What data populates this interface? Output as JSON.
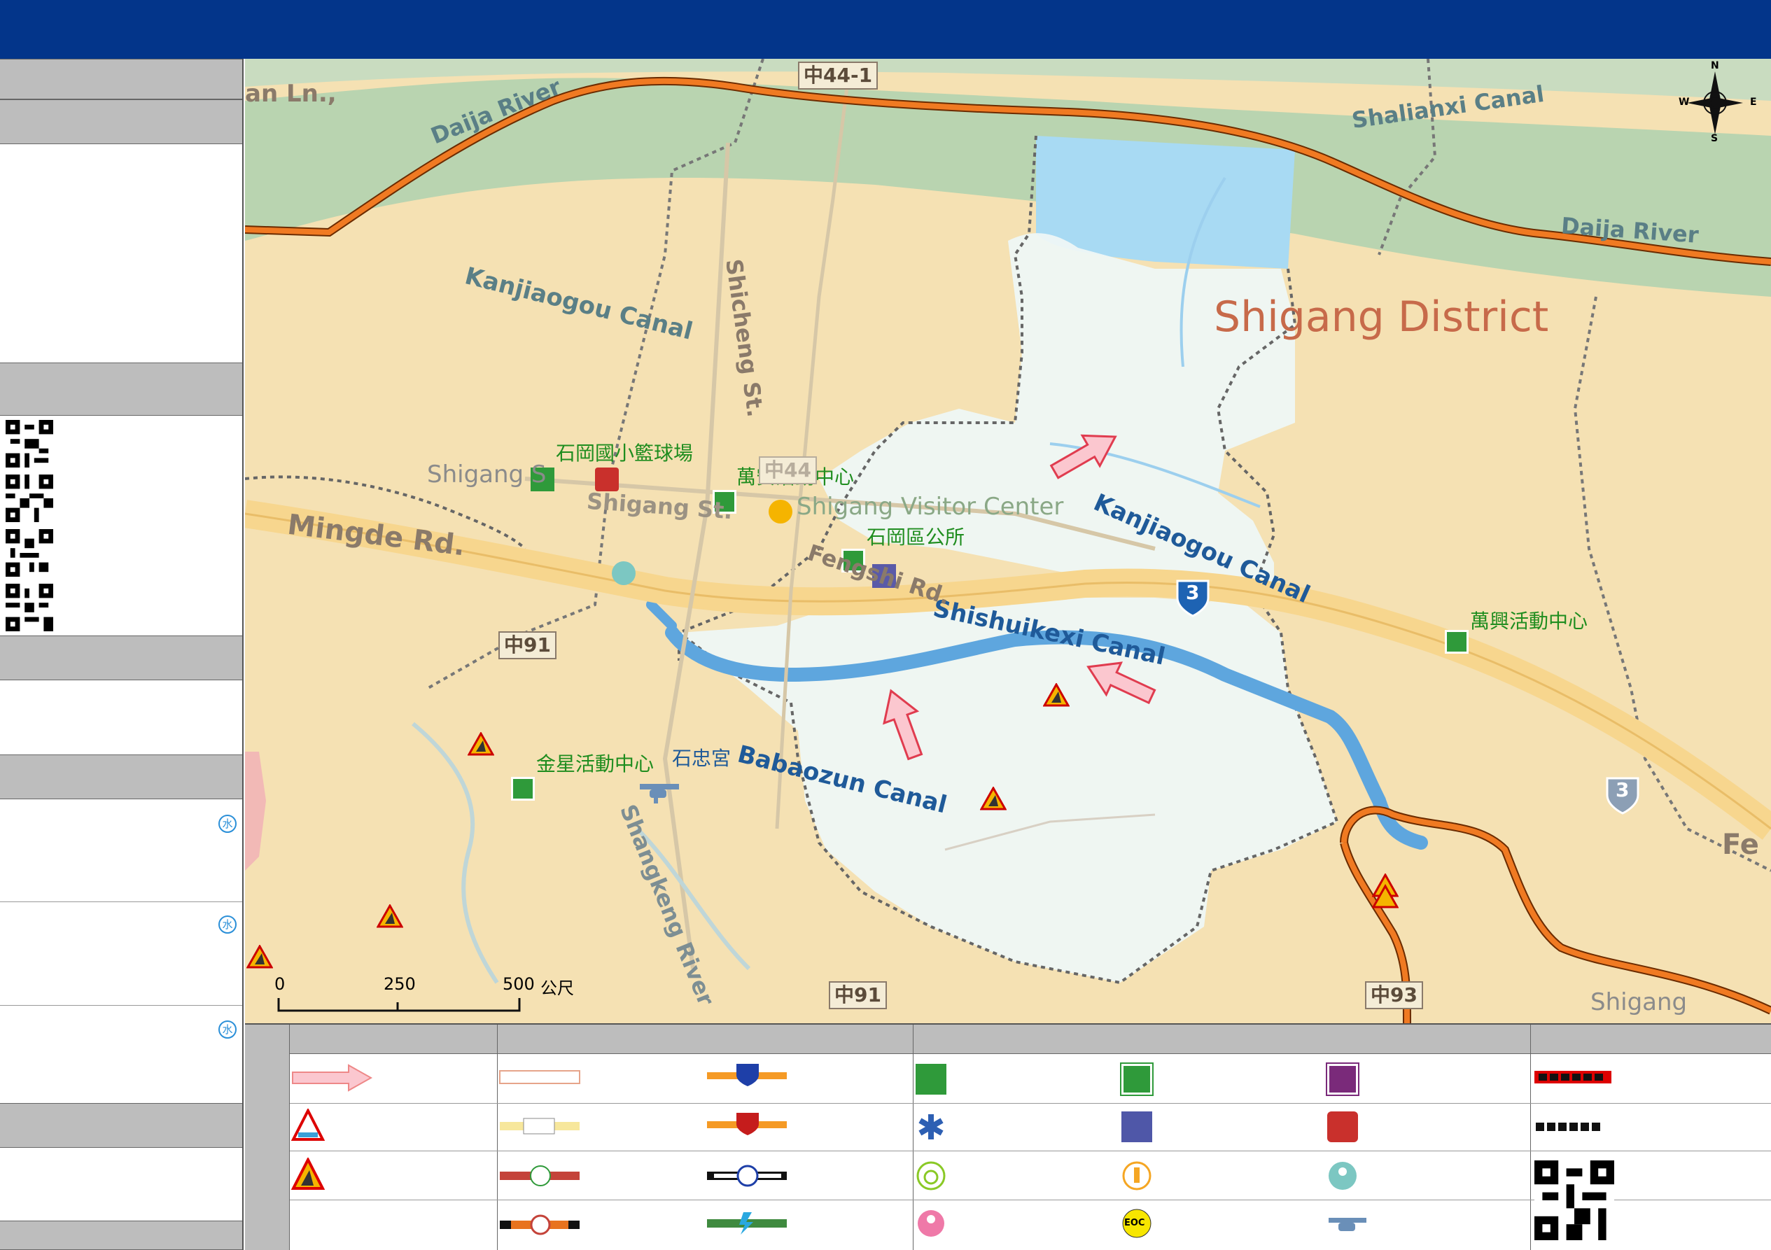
{
  "map": {
    "district_label": "Shigang District",
    "rivers": {
      "north": "Daija River",
      "east": "Daija River",
      "shalianxi": "Shalianxi Canal",
      "shangkeng": "Shangkeng River"
    },
    "canals": {
      "kanjiaogou_west": "Kanjiaogou Canal",
      "kanjiaogou_east": "Kanjiaogou Canal",
      "shishuikexi": "Shishuikexi Canal",
      "babaozun": "Babaozun Canal"
    },
    "roads": {
      "mingde": "Mingde Rd.",
      "shicheng": "Shicheng St.",
      "fengshi": "Fengshi Rd.",
      "shigang_st": "Shigang St.",
      "ln": "an Ln.,",
      "fe": "Fe"
    },
    "route_shields": {
      "r44_1": "中44-1",
      "r91_a": "中91",
      "r91_b": "中91",
      "r93": "中93",
      "freeway_a": "3",
      "freeway_b": "3",
      "r44": "中44"
    },
    "places": {
      "shigang_s": "Shigang S",
      "shigang": "Shigang"
    },
    "pois": {
      "basketball": "石岡國小籃球場",
      "wanan": "萬安活動中心",
      "visitor_center": "Shigang Visitor Center",
      "district_office": "石岡區公所",
      "wanxing": "萬興活動中心",
      "jinxing": "金星活動中心",
      "shizhong": "石忠宮"
    },
    "scale": {
      "t0": "0",
      "t250": "250",
      "t500": "500",
      "unit": "公尺"
    },
    "compass": {
      "n": "N",
      "s": "S",
      "e": "E",
      "w": "W"
    }
  },
  "sidebar": {
    "water_badge": "水"
  },
  "legend": {
    "eoc_label": "EOC"
  },
  "colors": {
    "header": "#03358a",
    "boundary": "#e8731e",
    "water": "#a8daf3",
    "risk_zone": "#eef7f5",
    "land": "#f5e1b3",
    "green_band": "#b9d4b0"
  },
  "icon_names": [
    "flow-arrow-icon",
    "water-warning-icon",
    "landslide-icon",
    "shelter-icon",
    "police-icon",
    "fire-icon",
    "medical-icon",
    "elderly-icon",
    "infant-icon",
    "helipad-icon",
    "eoc-icon",
    "qr-code-icon",
    "compass-icon"
  ]
}
